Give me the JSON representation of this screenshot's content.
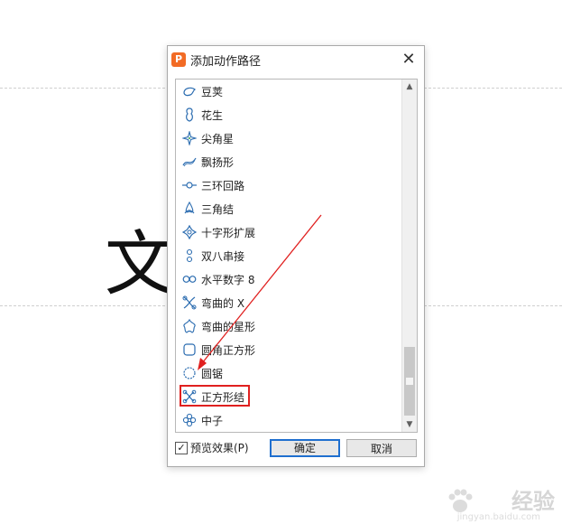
{
  "slide": {
    "char": "文"
  },
  "dialog": {
    "title": "添加动作路径",
    "close_glyph": "✕",
    "items": [
      {
        "label": "豆荚",
        "icon": "pea-pod-icon"
      },
      {
        "label": "花生",
        "icon": "peanut-icon"
      },
      {
        "label": "尖角星",
        "icon": "sharp-star-icon"
      },
      {
        "label": "飘扬形",
        "icon": "flutter-icon"
      },
      {
        "label": "三环回路",
        "icon": "triple-loop-icon"
      },
      {
        "label": "三角结",
        "icon": "triangle-knot-icon"
      },
      {
        "label": "十字形扩展",
        "icon": "cross-expand-icon"
      },
      {
        "label": "双八串接",
        "icon": "double-eight-icon"
      },
      {
        "label": "水平数字 8",
        "icon": "horizontal-eight-icon"
      },
      {
        "label": "弯曲的 X",
        "icon": "curved-x-icon"
      },
      {
        "label": "弯曲的星形",
        "icon": "curved-star-icon"
      },
      {
        "label": "圆角正方形",
        "icon": "rounded-square-icon"
      },
      {
        "label": "圆锯",
        "icon": "circular-saw-icon"
      },
      {
        "label": "正方形结",
        "icon": "square-knot-icon"
      },
      {
        "label": "中子",
        "icon": "neutron-icon"
      }
    ],
    "selected_index": 13,
    "preview": {
      "label": "预览效果(P)",
      "checked": true,
      "check_glyph": "✓"
    },
    "ok_label": "确定",
    "cancel_label": "取消",
    "scroll_up_glyph": "▲",
    "scroll_down_glyph": "▼"
  },
  "colors": {
    "accent": "#1f6fcf",
    "highlight": "#e0201f",
    "icon": "#2b6cb0",
    "app_icon": "#f26b25"
  },
  "watermark": {
    "text": "经验",
    "sub": "jingyan.baidu.com"
  }
}
